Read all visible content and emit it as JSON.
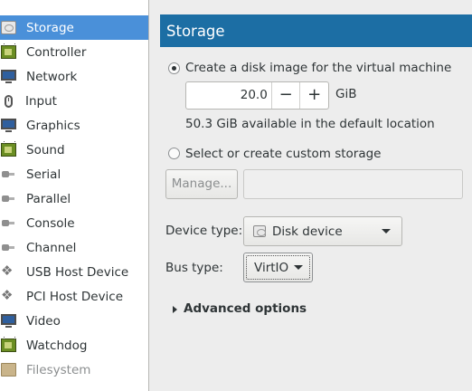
{
  "sidebar": {
    "items": [
      {
        "label": "Storage",
        "icon": "disk-icon"
      },
      {
        "label": "Controller",
        "icon": "chip-icon"
      },
      {
        "label": "Network",
        "icon": "network-icon"
      },
      {
        "label": "Input",
        "icon": "mouse-icon"
      },
      {
        "label": "Graphics",
        "icon": "monitor-icon"
      },
      {
        "label": "Sound",
        "icon": "sound-card-icon"
      },
      {
        "label": "Serial",
        "icon": "serial-plug-icon"
      },
      {
        "label": "Parallel",
        "icon": "parallel-plug-icon"
      },
      {
        "label": "Console",
        "icon": "console-plug-icon"
      },
      {
        "label": "Channel",
        "icon": "channel-plug-icon"
      },
      {
        "label": "USB Host Device",
        "icon": "usb-icon"
      },
      {
        "label": "PCI Host Device",
        "icon": "pci-icon"
      },
      {
        "label": "Video",
        "icon": "video-monitor-icon"
      },
      {
        "label": "Watchdog",
        "icon": "watchdog-chip-icon"
      },
      {
        "label": "Filesystem",
        "icon": "folder-icon"
      }
    ],
    "selected_index": 0,
    "disabled_index": 14
  },
  "header": {
    "title": "Storage"
  },
  "storage": {
    "create_option": "Create a disk image for the virtual machine",
    "size_value": "20.0",
    "minus": "−",
    "plus": "+",
    "unit": "GiB",
    "available": "50.3 GiB available in the default location",
    "custom_option": "Select or create custom storage",
    "manage_button": "Manage...",
    "custom_path": ""
  },
  "device": {
    "label": "Device type:",
    "value": "Disk device",
    "icon": "disk-icon"
  },
  "bus": {
    "label": "Bus type:",
    "value": "VirtIO"
  },
  "advanced": {
    "label": "Advanced options"
  },
  "colors": {
    "header_bg": "#1c6ea4",
    "selection_bg": "#4a90d9"
  }
}
